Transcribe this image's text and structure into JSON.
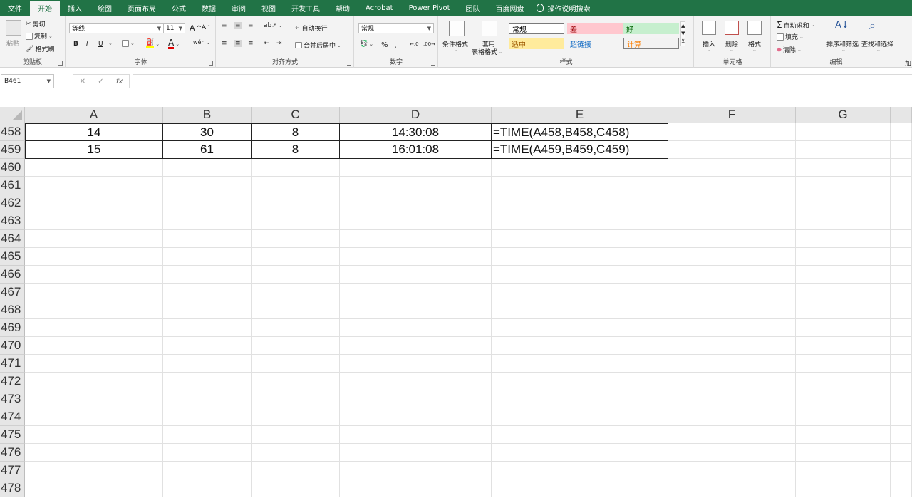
{
  "tabs": [
    "文件",
    "开始",
    "插入",
    "绘图",
    "页面布局",
    "公式",
    "数据",
    "审阅",
    "视图",
    "开发工具",
    "帮助",
    "Acrobat",
    "Power Pivot",
    "团队",
    "百度网盘"
  ],
  "active_tab_index": 1,
  "tell_me": "操作说明搜索",
  "ribbon": {
    "clipboard": {
      "paste": "粘贴",
      "cut": "剪切",
      "copy": "复制",
      "format_painter": "格式刷",
      "label": "剪贴板"
    },
    "font": {
      "name": "等线",
      "size": "11",
      "label": "字体",
      "bold": "B",
      "italic": "I",
      "underline": "U",
      "grow": "A",
      "shrink": "A",
      "font_color": "A",
      "phonetic": "wén"
    },
    "alignment": {
      "wrap": "自动换行",
      "merge": "合并后居中",
      "label": "对齐方式"
    },
    "number": {
      "format": "常规",
      "percent": "%",
      "comma": ",",
      "label": "数字"
    },
    "styles": {
      "conditional": "条件格式",
      "table_top": "套用",
      "table_bottom": "表格格式",
      "cells": [
        {
          "label": "常规",
          "bg": "#ffffff",
          "color": "#000000"
        },
        {
          "label": "差",
          "bg": "#ffc7ce",
          "color": "#9c0006"
        },
        {
          "label": "好",
          "bg": "#c6efce",
          "color": "#006100"
        },
        {
          "label": "适中",
          "bg": "#ffeb9c",
          "color": "#9c5700"
        },
        {
          "label": "超链接",
          "bg": "#f3f3f3",
          "color": "#0563c1"
        },
        {
          "label": "计算",
          "bg": "#f2f2f2",
          "color": "#fa7d00"
        }
      ],
      "label": "样式"
    },
    "cells_grp": {
      "insert": "插入",
      "delete": "删除",
      "format": "格式",
      "label": "单元格"
    },
    "editing": {
      "autosum": "自动求和",
      "fill": "填充",
      "clear": "清除",
      "sort": "排序和筛选",
      "find": "查找和选择",
      "label": "编辑"
    },
    "addins_partial": "加"
  },
  "formula_bar": {
    "name_box": "B461",
    "fx": "fx",
    "formula": ""
  },
  "columns": [
    "A",
    "B",
    "C",
    "D",
    "E",
    "F",
    "G"
  ],
  "rows": [
    {
      "num": "458",
      "A": "14",
      "B": "30",
      "C": "8",
      "D": "14:30:08",
      "E": "=TIME(A458,B458,C458)"
    },
    {
      "num": "459",
      "A": "15",
      "B": "61",
      "C": "8",
      "D": "16:01:08",
      "E": "=TIME(A459,B459,C459)"
    },
    {
      "num": "460"
    },
    {
      "num": "461"
    },
    {
      "num": "462"
    },
    {
      "num": "463"
    },
    {
      "num": "464"
    },
    {
      "num": "465"
    },
    {
      "num": "466"
    },
    {
      "num": "467"
    },
    {
      "num": "468"
    },
    {
      "num": "469"
    },
    {
      "num": "470"
    },
    {
      "num": "471"
    },
    {
      "num": "472"
    },
    {
      "num": "473"
    },
    {
      "num": "474"
    },
    {
      "num": "475"
    },
    {
      "num": "476"
    },
    {
      "num": "477"
    },
    {
      "num": "478"
    }
  ]
}
